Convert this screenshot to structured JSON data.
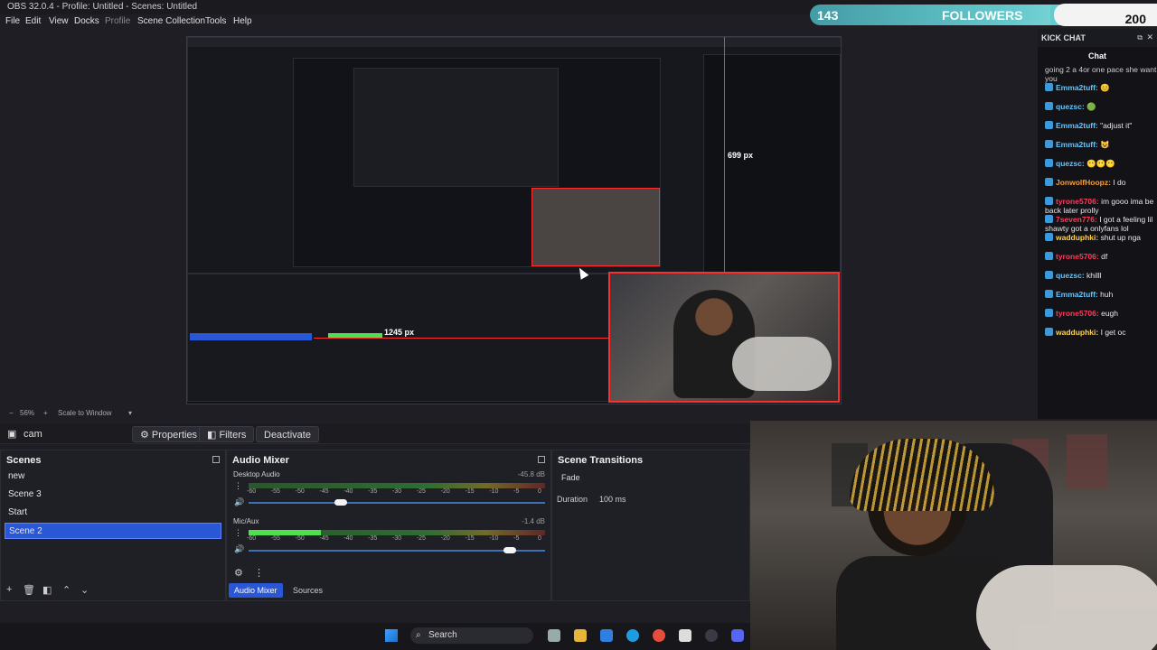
{
  "window": {
    "title": "OBS 32.0.4 - Profile: Untitled - Scenes: Untitled"
  },
  "menu": [
    "File",
    "Edit",
    "View",
    "Docks",
    "Profile",
    "Scene Collection",
    "Tools",
    "Help"
  ],
  "followers_overlay": {
    "current": "143",
    "label": "FOLLOWERS",
    "goal": "200",
    "progress": 0.715
  },
  "preview": {
    "width_readout": "1245 px",
    "height_readout": "699 px",
    "nested_width": "1245 px",
    "nested_height": "699 px"
  },
  "zoom": {
    "level": "56%",
    "fit": "Scale to Window"
  },
  "source_toolbar": {
    "source_name": "cam",
    "properties": "Properties",
    "filters": "Filters",
    "deactivate": "Deactivate"
  },
  "scenes": {
    "title": "Scenes",
    "items": [
      "new",
      "Scene 3",
      "Start",
      "Scene 2"
    ],
    "selected": "Scene 2"
  },
  "audio_mixer": {
    "title": "Audio Mixer",
    "channels": [
      {
        "name": "Desktop Audio",
        "db": "-45.8 dB",
        "volume": 0.31
      },
      {
        "name": "Mic/Aux",
        "db": "-1.4 dB",
        "volume": 0.88
      }
    ],
    "ticks": [
      "-60",
      "-55",
      "-50",
      "-45",
      "-40",
      "-35",
      "-30",
      "-25",
      "-20",
      "-15",
      "-10",
      "-5",
      "0"
    ]
  },
  "bottom_tabs": {
    "active": "Audio Mixer",
    "other": "Sources"
  },
  "transitions": {
    "title": "Scene Transitions",
    "selected": "Fade",
    "duration_label": "Duration",
    "duration_value": "100 ms"
  },
  "chat": {
    "header": "KICK CHAT",
    "tab": "Chat",
    "messages": [
      {
        "name": "",
        "text": "going 2 a 4or one pace she want you",
        "color": "#cfcfcf"
      },
      {
        "name": "Emma2tuff:",
        "text": "😊",
        "color": "#62c7ff"
      },
      {
        "name": "quezsc:",
        "text": "🟢",
        "color": "#62c7ff"
      },
      {
        "name": "Emma2tuff:",
        "text": "\"adjust it\"",
        "color": "#62c7ff"
      },
      {
        "name": "Emma2tuff:",
        "text": "😺",
        "color": "#62c7ff"
      },
      {
        "name": "quezsc:",
        "text": "😶😶😶",
        "color": "#62c7ff"
      },
      {
        "name": "JonwolfHoopz:",
        "text": "I do",
        "color": "#ff9e2c"
      },
      {
        "name": "tyrone5706:",
        "text": "im gooo ima be back later prolly",
        "color": "#ff3c5a"
      },
      {
        "name": "7seven776:",
        "text": "I got a feeling lil shawty got a onlyfans lol",
        "color": "#ff3c5a"
      },
      {
        "name": "wadduphki:",
        "text": "shut up nga",
        "color": "#ffd24a"
      },
      {
        "name": "tyrone5706:",
        "text": "df",
        "color": "#ff3c5a"
      },
      {
        "name": "quezsc:",
        "text": "khilll",
        "color": "#62c7ff"
      },
      {
        "name": "Emma2tuff:",
        "text": "huh",
        "color": "#62c7ff"
      },
      {
        "name": "tyrone5706:",
        "text": "eugh",
        "color": "#ff3c5a"
      },
      {
        "name": "wadduphki:",
        "text": "I get oc",
        "color": "#ffd24a"
      }
    ]
  },
  "taskbar": {
    "search": "Search"
  },
  "colors": {
    "accent": "#2a57d6",
    "selection_border": "#ff2d2d",
    "chat_green": "#2fd35a"
  }
}
